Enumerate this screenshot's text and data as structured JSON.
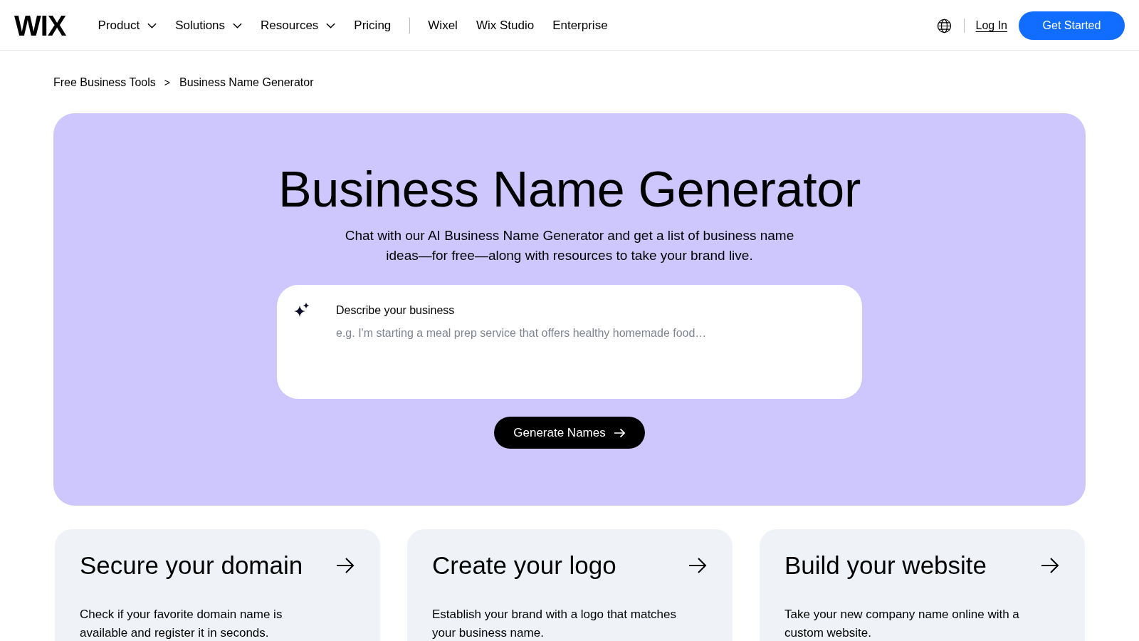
{
  "header": {
    "logo": "WIX",
    "menu": [
      {
        "label": "Product",
        "dropdown": true
      },
      {
        "label": "Solutions",
        "dropdown": true
      },
      {
        "label": "Resources",
        "dropdown": true
      },
      {
        "label": "Pricing",
        "dropdown": false
      }
    ],
    "products": [
      "Wixel",
      "Wix Studio",
      "Enterprise"
    ],
    "login": "Log In",
    "cta": "Get Started"
  },
  "breadcrumb": {
    "items": [
      "Free Business Tools",
      "Business Name Generator"
    ],
    "separator": ">"
  },
  "hero": {
    "title": "Business Name Generator",
    "subtitle": "Chat with our AI Business Name Generator and get a list of business name ideas—for free—along with resources to take your brand live.",
    "prompt": {
      "label": "Describe your business",
      "placeholder": "e.g. I'm starting a meal prep service that offers healthy homemade food…"
    },
    "button": "Generate Names"
  },
  "cards": [
    {
      "title": "Secure your domain",
      "description": "Check if your favorite domain name is available and register it in seconds."
    },
    {
      "title": "Create your logo",
      "description": "Establish your brand with a logo that matches your business name."
    },
    {
      "title": "Build your website",
      "description": "Take your new company name online with a custom website."
    }
  ]
}
